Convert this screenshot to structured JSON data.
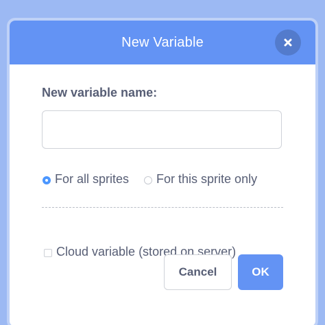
{
  "dialog": {
    "title": "New Variable",
    "close_icon": "close-icon"
  },
  "form": {
    "name_label": "New variable name:",
    "name_value": "",
    "name_placeholder": "",
    "scope_options": [
      {
        "label": "For all sprites",
        "selected": true
      },
      {
        "label": "For this sprite only",
        "selected": false
      }
    ],
    "cloud_label": "Cloud variable (stored on server)",
    "cloud_checked": false
  },
  "actions": {
    "cancel_label": "Cancel",
    "ok_label": "OK"
  },
  "colors": {
    "header": "#6393f4",
    "accent": "#4c97ff",
    "text": "#575e75",
    "backdrop": "#9cb9f3"
  }
}
